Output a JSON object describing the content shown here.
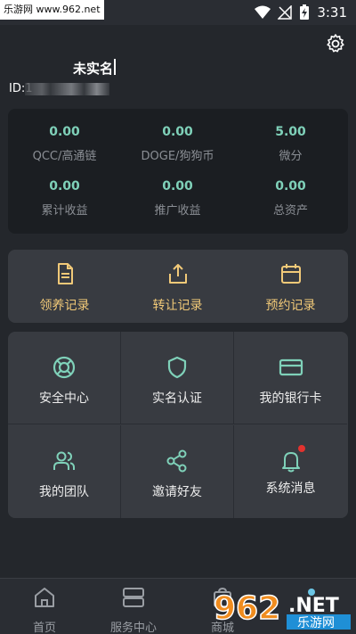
{
  "status_bar": {
    "site_tag": "乐游网 www.962.net",
    "time": "3:31"
  },
  "profile": {
    "name": "未实名",
    "id_prefix": "ID:1"
  },
  "assets": [
    {
      "value": "0.00",
      "label": "QCC/高通链"
    },
    {
      "value": "0.00",
      "label": "DOGE/狗狗币"
    },
    {
      "value": "5.00",
      "label": "微分"
    },
    {
      "value": "0.00",
      "label": "累计收益"
    },
    {
      "value": "0.00",
      "label": "推广收益"
    },
    {
      "value": "0.00",
      "label": "总资产"
    }
  ],
  "records": [
    {
      "label": "领养记录",
      "icon": "document-icon"
    },
    {
      "label": "转让记录",
      "icon": "share-upload-icon"
    },
    {
      "label": "预约记录",
      "icon": "calendar-icon"
    }
  ],
  "grid": [
    {
      "label": "安全中心",
      "icon": "lifebuoy-icon"
    },
    {
      "label": "实名认证",
      "icon": "shield-icon"
    },
    {
      "label": "我的银行卡",
      "icon": "credit-card-icon"
    },
    {
      "label": "我的团队",
      "icon": "users-icon"
    },
    {
      "label": "邀请好友",
      "icon": "share-icon"
    },
    {
      "label": "系统消息",
      "icon": "bell-icon"
    }
  ],
  "nav": [
    {
      "label": "首页",
      "icon": "home-icon"
    },
    {
      "label": "服务中心",
      "icon": "server-icon"
    },
    {
      "label": "商城",
      "icon": "shopping-bag-icon"
    }
  ],
  "watermark": {
    "brand": "962",
    "suffix": ".NET",
    "site": "乐游网"
  },
  "colors": {
    "background": "#24272c",
    "card_dark": "#1b1e22",
    "card_light": "#383b41",
    "accent_teal": "#7fd1b9",
    "accent_gold": "#f1c978",
    "notification": "#e2322e"
  }
}
